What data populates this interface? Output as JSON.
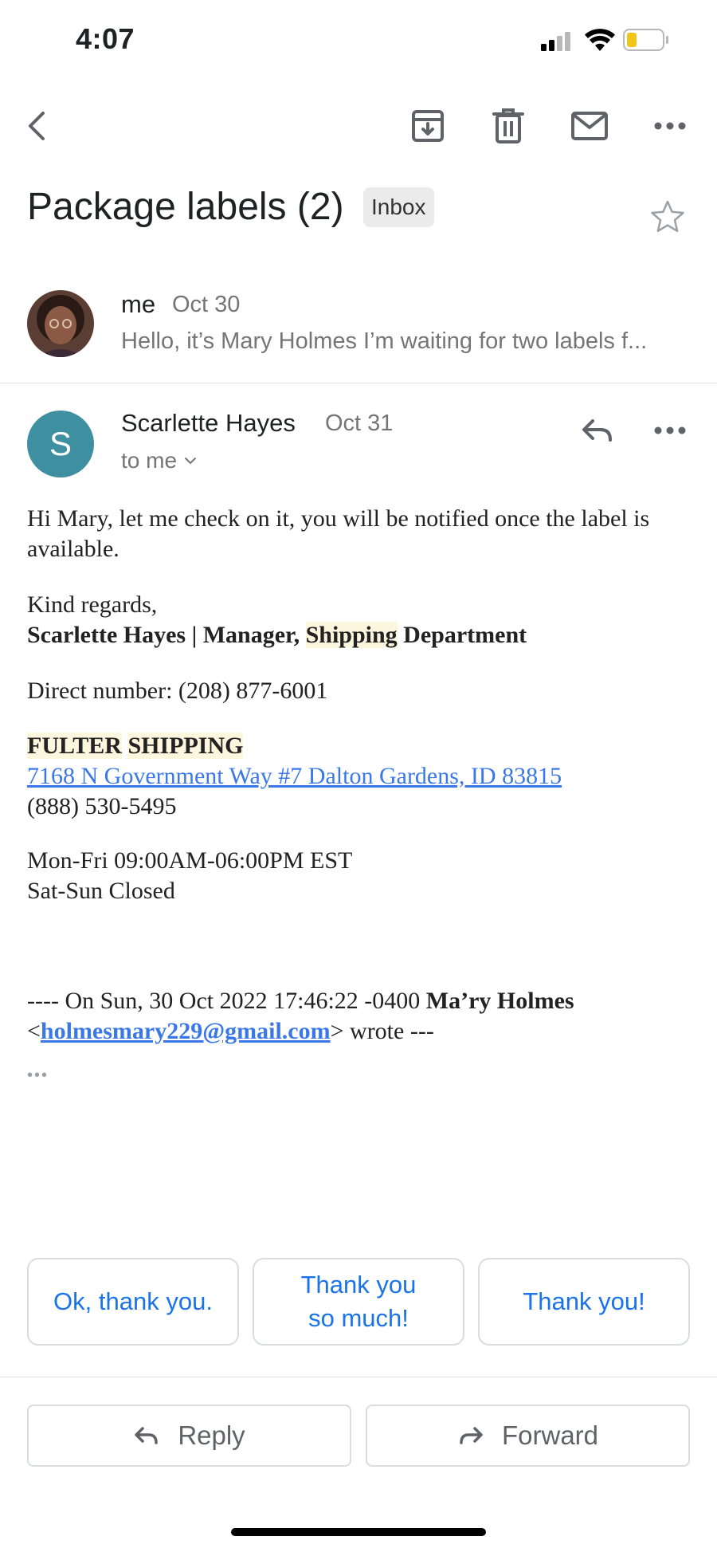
{
  "status_bar": {
    "time": "4:07"
  },
  "toolbar": {
    "back_icon": "chevron-left-icon",
    "archive_icon": "archive-icon",
    "delete_icon": "trash-icon",
    "mark_unread_icon": "mail-icon",
    "more_icon": "more-horizontal-icon"
  },
  "subject": {
    "title": "Package labels (2)",
    "label_chip": "Inbox"
  },
  "collapsed_message": {
    "sender": "me",
    "date": "Oct 30",
    "snippet": "Hello, it’s Mary Holmes I’m waiting for two labels f..."
  },
  "message": {
    "avatar_letter": "S",
    "sender": "Scarlette Hayes",
    "date": "Oct 31",
    "recipient_line": "to me",
    "body": {
      "line1": "Hi Mary, let me check on it, you will be notified once the label is available.",
      "regards": "Kind regards,",
      "sig_name": "Scarlette Hayes",
      "sig_sep": " | Manager, ",
      "sig_shipping": "Shipping",
      "sig_dept": " Department",
      "direct": "Direct number: (208) 877-6001",
      "company_a": "FULTER",
      "company_b": "SHIPPING",
      "address": "7168 N Government Way #7 Dalton Gardens, ID 83815",
      "phone": "(888) 530-5495",
      "hours1": "Mon-Fri 09:00AM-06:00PM EST",
      "hours2": "Sat-Sun Closed",
      "quote_prefix": "---- On Sun, 30 Oct 2022 17:46:22 -0400 ",
      "quote_name": "Ma’ry Holmes",
      "quote_lt": "<",
      "quote_email": "holmesmary229@gmail.com",
      "quote_suffix": "> wrote ---",
      "trimmed": "•••"
    }
  },
  "smart_replies": [
    "Ok, thank you.",
    "Thank you so much!",
    "Thank you!"
  ],
  "actions": {
    "reply": "Reply",
    "forward": "Forward"
  },
  "colors": {
    "accent": "#1a73e8",
    "avatar": "#3e8fa0",
    "highlight": "#fdf6de",
    "link": "#3b78e7"
  }
}
